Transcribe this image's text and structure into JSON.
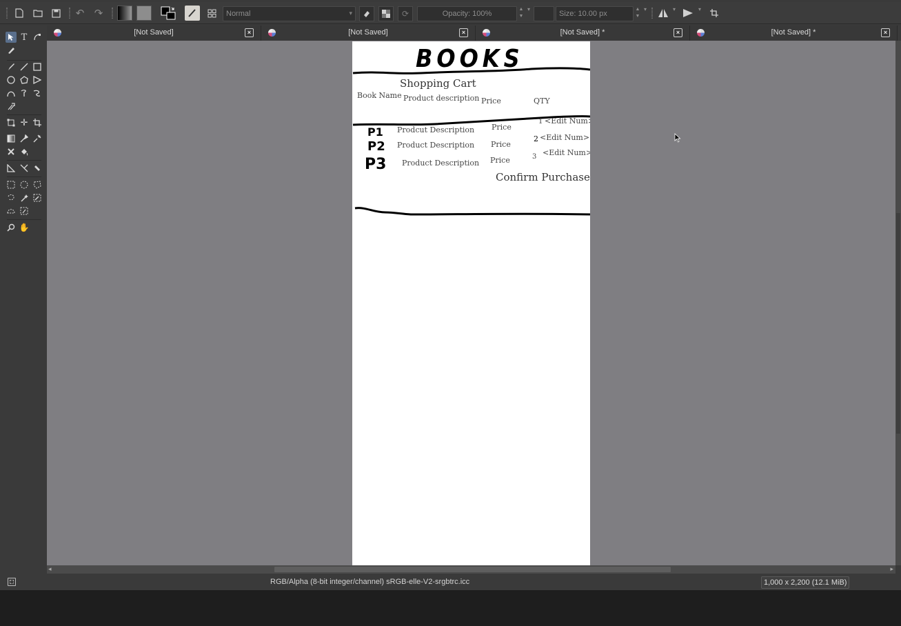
{
  "toolbar": {
    "blend_mode": "Normal",
    "opacity_label": "Opacity: 100%",
    "size_label": "Size: 10.00 px"
  },
  "tabs": [
    {
      "title": "[Not Saved]"
    },
    {
      "title": "[Not Saved]"
    },
    {
      "title": "[Not Saved]  *"
    },
    {
      "title": "[Not Saved]  *"
    }
  ],
  "sketch": {
    "header_word": "BOOKS",
    "heading": "Shopping Cart",
    "columns": [
      "Book Name",
      "Product description",
      "Price",
      "QTY"
    ],
    "rows": [
      {
        "name": "P1",
        "description": "Prodcut Description",
        "price": "Price",
        "qty": "1",
        "edit": "<Edit Num>"
      },
      {
        "name": "P2",
        "description": "Product Description",
        "price": "Price",
        "qty": "2",
        "edit": "<Edit Num>"
      },
      {
        "name": "P3",
        "description": "Product Description",
        "price": "Price",
        "qty": "3",
        "edit": "<Edit Num>"
      }
    ],
    "confirm": "Confirm Purchase"
  },
  "status": {
    "color_space": "RGB/Alpha (8-bit integer/channel)  sRGB-elle-V2-srgbtrc.icc",
    "image_size": "1,000 x 2,200 (12.1 MiB)"
  },
  "icons": [
    "new-document-icon",
    "open-icon",
    "save-icon",
    "undo-icon",
    "redo-icon",
    "gradient-icon",
    "pattern-icon",
    "swap-colors-icon",
    "brush-preset-icon",
    "workspace-icon",
    "eraser-icon",
    "alpha-lock-icon",
    "reload-icon",
    "mirror-horizontal-icon",
    "mirror-vertical-icon",
    "wrap-icon"
  ]
}
